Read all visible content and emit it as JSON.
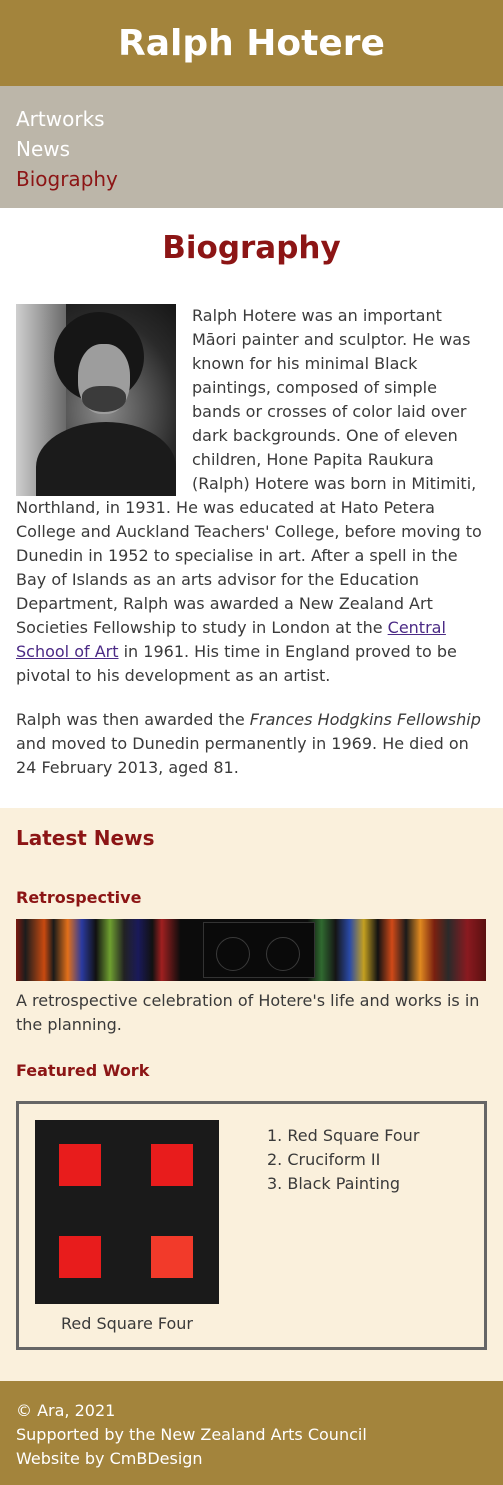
{
  "header": {
    "title": "Ralph Hotere"
  },
  "nav": {
    "items": [
      {
        "label": "Artworks"
      },
      {
        "label": "News"
      },
      {
        "label": "Biography"
      }
    ]
  },
  "bio": {
    "title": "Biography",
    "p1_before_link": "Ralph Hotere was an important Māori painter and sculptor. He was known for his minimal Black paintings, composed of simple bands or crosses of color laid over dark backgrounds. One of eleven children, Hone Papita Raukura (Ralph) Hotere was born in Mitimiti, Northland, in 1931. He was educated at Hato Petera College and Auckland Teachers' College, before moving to Dunedin in 1952 to specialise in art. After a spell in the Bay of Islands as an arts advisor for the Education Department, Ralph was awarded a New Zealand Art Societies Fellowship to study in London at the ",
    "p1_link": "Central School of Art",
    "p1_after_link": " in 1961. His time in England proved to be pivotal to his development as an artist.",
    "p2_before_em": "Ralph was then awarded the ",
    "p2_em": "Frances Hodgkins Fellowship",
    "p2_after_em": " and moved to Dunedin permanently in 1969. He died on 24 February 2013, aged 81."
  },
  "news": {
    "title": "Latest News",
    "retro_title": "Retrospective",
    "retro_text": "A retrospective celebration of Hotere's life and works is in the planning.",
    "featured_title": "Featured Work",
    "featured_caption": "Red Square Four",
    "works": [
      "1. Red Square Four",
      "2. Cruciform II",
      "3. Black Painting"
    ]
  },
  "footer": {
    "line1": "© Ara, 2021",
    "line2": "Supported by the New Zealand Arts Council",
    "line3": "Website by CmBDesign"
  },
  "colors": {
    "brand_gold": "#a3843c",
    "nav_grey": "#bcb6a9",
    "accent_red": "#8c1515",
    "news_bg": "#faf0dc"
  }
}
